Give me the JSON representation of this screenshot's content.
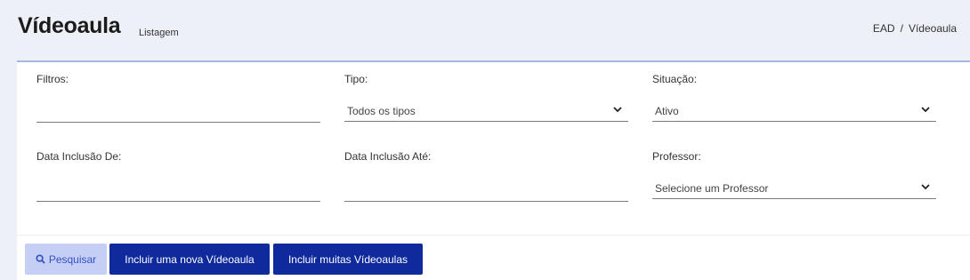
{
  "header": {
    "title": "Vídeoaula",
    "subtitle": "Listagem",
    "breadcrumb": [
      "EAD",
      "/",
      "Vídeoaula"
    ]
  },
  "filters": {
    "filtros": {
      "label": "Filtros:",
      "value": ""
    },
    "tipo": {
      "label": "Tipo:",
      "selected": "Todos os tipos"
    },
    "situacao": {
      "label": "Situação:",
      "selected": "Ativo"
    },
    "data_de": {
      "label": "Data Inclusão De:",
      "value": ""
    },
    "data_ate": {
      "label": "Data Inclusão Até:",
      "value": ""
    },
    "professor": {
      "label": "Professor:",
      "selected": "Selecione um Professor"
    }
  },
  "actions": {
    "search_label": "Pesquisar",
    "new_label": "Incluir uma nova Vídeoaula",
    "many_label": "Incluir muitas Vídeoaulas"
  },
  "icons": {
    "search": "search-icon",
    "dropdown": "chevron-down-icon"
  },
  "colors": {
    "primary": "#0e2a9c",
    "search_bg": "#c5cff5",
    "search_fg": "#3550c4",
    "page_bg": "#eef0f8"
  }
}
